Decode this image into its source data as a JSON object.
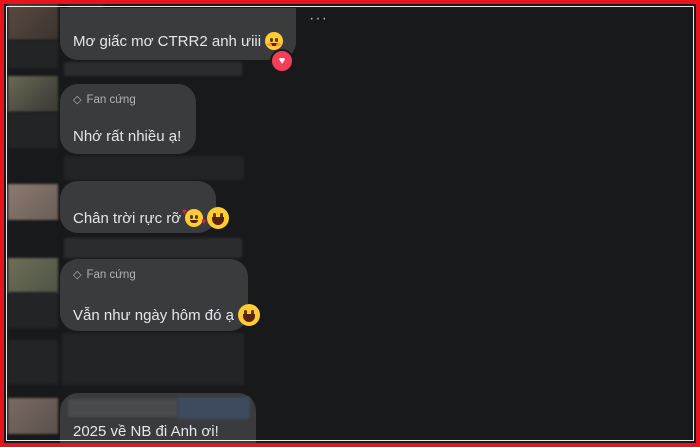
{
  "comments": [
    {
      "badge": "",
      "text": "Mơ giấc mơ CTRR2 anh ưiii",
      "emoji": [
        "smiling-face"
      ]
    },
    {
      "badge": "Fan cứng",
      "text": "Nhớ rất nhiều ạ!",
      "emoji": []
    },
    {
      "badge": "",
      "text": "Chân trời rực rỡ",
      "emoji": [
        "smiling-face-with-hearts",
        "grinning-face"
      ]
    },
    {
      "badge": "Fan cứng",
      "text": "Vẫn như ngày hôm đó ạ",
      "emoji": [
        "grinning-face"
      ]
    },
    {
      "badge": "",
      "text": "2025 về NB đi Anh ơi!",
      "emoji": []
    }
  ],
  "more_options": "···",
  "reaction": {
    "icon": "heart-reaction-icon",
    "color": "#f33e58"
  },
  "colors": {
    "background": "#18191a",
    "bubble": "#3a3b3c",
    "frame": "#e8141b"
  }
}
